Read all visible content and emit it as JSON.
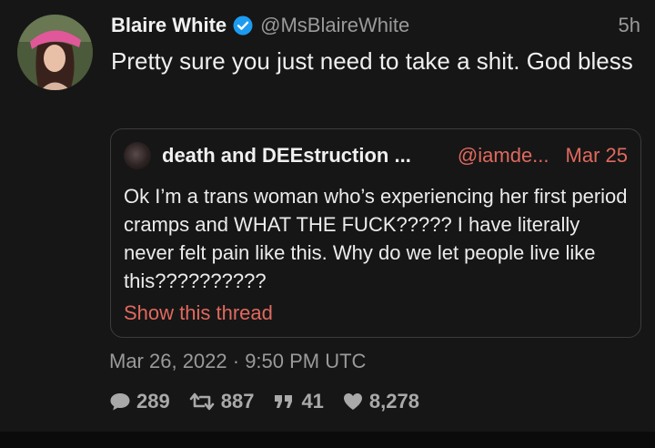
{
  "tweet": {
    "author_name": "Blaire White",
    "handle": "@MsBlaireWhite",
    "time": "5h",
    "text": "Pretty sure you just need to take a shit. God bless",
    "date": "Mar 26, 2022 · 9:50 PM UTC",
    "avatar_icon": "profile-photo",
    "verified_icon": "verified-badge-icon",
    "verified_color": "#1d9bf0"
  },
  "quote": {
    "author_name": "death and DEEstruction ...",
    "handle": "@iamde...",
    "date": "Mar 25",
    "text": "Ok I’m a trans woman who’s experiencing her first period cramps and WHAT THE FUCK????? I have literally never felt pain like this. Why do we let people live like this??????????",
    "show_thread_label": "Show this thread",
    "accent_color": "#e0695e"
  },
  "stats": {
    "replies": "289",
    "retweets": "887",
    "quotes": "41",
    "likes": "8,278",
    "icons": [
      "comment-icon",
      "retweet-icon",
      "quote-icon",
      "heart-icon"
    ]
  }
}
